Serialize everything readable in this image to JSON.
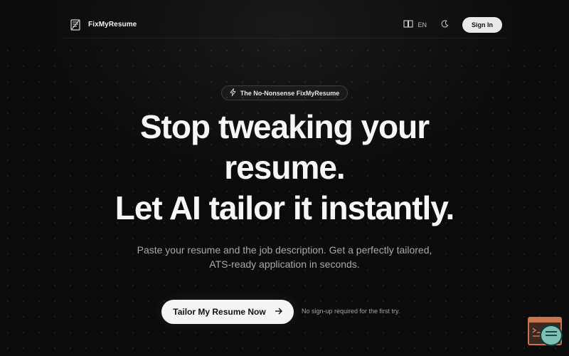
{
  "header": {
    "brand_name": "FixMyResume",
    "brand_icon": "document-lines-icon",
    "language_label": "EN",
    "language_icon": "book-open-icon",
    "theme_icon": "moon-icon",
    "signin_label": "Sign In"
  },
  "hero": {
    "badge_icon": "lightning-icon",
    "badge_text": "The No-Nonsense FixMyResume",
    "headline_line1": "Stop tweaking your",
    "headline_line2": "resume.",
    "headline_line3": "Let AI tailor it instantly.",
    "subtext_line1": "Paste your resume and the job description. Get a perfectly tailored,",
    "subtext_line2": "ATS-ready application in seconds.",
    "cta_label": "Tailor My Resume Now",
    "cta_icon": "arrow-right-icon",
    "cta_note": "No sign-up required for the first try."
  },
  "widgets": {
    "terminal_icon": "terminal-window-icon",
    "chat_icon": "chat-bubble-icon"
  },
  "colors": {
    "background": "#0b0b0b",
    "button_light": "#f5f5f5",
    "widget_orange": "#c9744a",
    "widget_teal": "#7fc0b5"
  }
}
